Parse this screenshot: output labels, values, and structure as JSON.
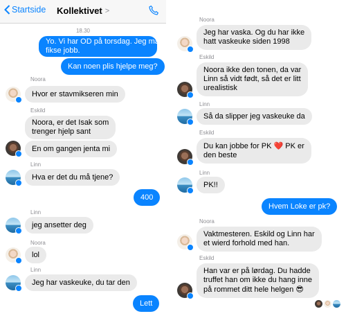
{
  "header": {
    "back_label": "Startside",
    "title": "Kollektivet",
    "title_chevron": ">",
    "back_icon": "chevron-left-icon",
    "call_icon": "phone-icon"
  },
  "left": {
    "time": "18.30",
    "messages": [
      {
        "from": "me",
        "text": "Yo. Vi har OD på torsdag. Jeg må"
      },
      {
        "from": "me",
        "text": "fikse jobb."
      },
      {
        "from": "me",
        "text": "Kan noen plis hjelpe meg?"
      },
      {
        "from": "Noora",
        "text": "Hvor er stavmikseren min"
      },
      {
        "from": "Eskild",
        "text": "Noora, er det Isak som"
      },
      {
        "from": "Eskild",
        "text": "trenger hjelp sant"
      },
      {
        "from": "Eskild",
        "text": "En om gangen jenta mi"
      },
      {
        "from": "Linn",
        "text": "Hva er det du må tjene?"
      },
      {
        "from": "me",
        "text": "400"
      },
      {
        "from": "Linn",
        "text": "jeg ansetter deg"
      },
      {
        "from": "Noora",
        "text": "lol"
      },
      {
        "from": "Linn",
        "text": "Jeg har vaskeuke, du tar den"
      },
      {
        "from": "me",
        "text": "Lett"
      }
    ],
    "names": [
      "Noora",
      "Eskild",
      "Linn",
      "Linn",
      "Noora",
      "Linn"
    ]
  },
  "right": {
    "messages": [
      {
        "from": "Noora",
        "lines": [
          "Jeg har vaska. Og du har ikke",
          "hatt vaskeuke siden 1998"
        ]
      },
      {
        "from": "Eskild",
        "lines": [
          "Noora ikke den tonen, da var",
          "Linn så vidt født, så det er litt",
          "urealistisk"
        ]
      },
      {
        "from": "Linn",
        "lines": [
          "Så da slipper jeg vaskeuke da"
        ]
      },
      {
        "from": "Eskild",
        "lines": [
          "Du kan jobbe for PK",
          "PK er",
          "den beste"
        ]
      },
      {
        "from": "Linn",
        "lines": [
          "PK!!"
        ]
      },
      {
        "from": "me",
        "lines": [
          "Hvem Loke er pk?"
        ]
      },
      {
        "from": "Noora",
        "lines": [
          "Vaktmesteren. Eskild og Linn har",
          "et wierd forhold med han."
        ]
      },
      {
        "from": "Eskild",
        "lines": [
          "Han var er på lørdag. Du hadde",
          "truffet han om ikke du hang inne",
          "på rommet ditt hele helgen"
        ]
      }
    ],
    "heart": "❤️",
    "emoji": "😎",
    "names": [
      "Noora",
      "Eskild",
      "Linn",
      "Eskild",
      "Linn",
      "Noora",
      "Eskild"
    ]
  },
  "colors": {
    "accent": "#0a84ff",
    "incoming": "#eaeaea",
    "muted": "#8e8e93"
  }
}
